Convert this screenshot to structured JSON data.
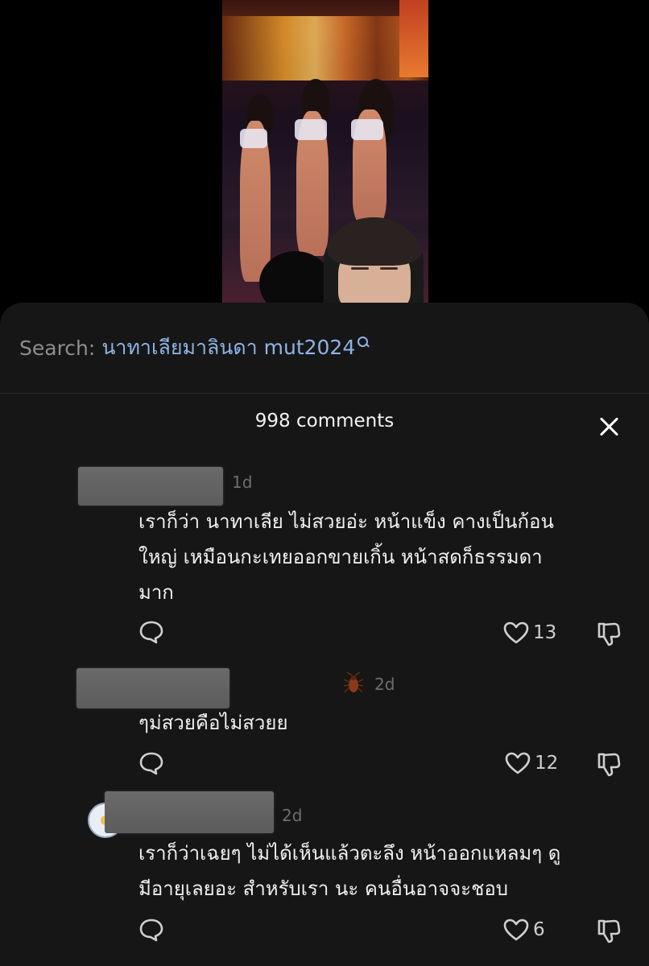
{
  "search": {
    "label": "Search:",
    "query": "นาทาเลียมาลินดา mut2024"
  },
  "comments_header": {
    "title": "998 comments"
  },
  "comments": [
    {
      "time": "1d",
      "text": "เราก็ว่า นาทาเลีย ไม่สวยอ่ะ หน้าแข็ง คางเป็นก้อนใหญ่ เหมือนกะเทยออกขายเกิ้น หน้าสดก็ธรรมดามาก",
      "lines": [
        "เราก็ว่า นาทาเลีย ไม่สวยอ่ะ หน้าแข็ง คางเป็นก้อน",
        "ใหญ่ เหมือนกะเทยออกขายเกิ้น หน้าสดก็ธรรมดา",
        "มาก"
      ],
      "likes": "13"
    },
    {
      "time": "2d",
      "badge_icon": "cockroach-icon",
      "text": "ๆม่สวยคือไม่สวยย",
      "lines": [
        "ๆม่สวยคือไม่สวยย"
      ],
      "likes": "12"
    },
    {
      "time": "2d",
      "text": "เราก็ว่าเฉยๆ ไม่ได้เห็นแล้วตะลึง หน้าออกแหลมๆ ดูมีอายุเลยอะ สำหรับเรา นะ คนอื่นอาจจะชอบ",
      "lines": [
        "เราก็ว่าเฉยๆ ไม่ได้เห็นแล้วตะลึง หน้าออกแหลมๆ ดู",
        "มีอายุเลยอะ สำหรับเรา นะ คนอื่นอาจจะชอบ"
      ],
      "likes": "6"
    }
  ],
  "colors": {
    "sheet_bg": "#161616",
    "search_query": "#8fb3e6",
    "muted_text": "#6e6e6e"
  },
  "icons": [
    "search-icon",
    "close-icon",
    "reply-icon",
    "heart-icon",
    "dislike-icon",
    "cockroach-icon"
  ]
}
